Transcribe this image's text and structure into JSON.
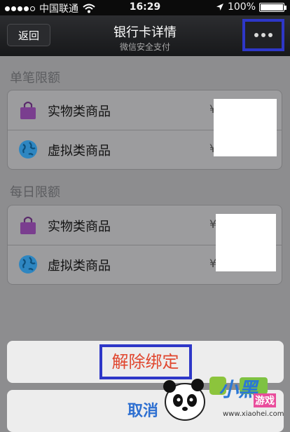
{
  "status_bar": {
    "carrier": "中国联通",
    "time": "16:29",
    "battery_percent": "100%",
    "signal_bars": 4,
    "battery_level": 1.0
  },
  "nav": {
    "back_label": "返回",
    "title": "银行卡详情",
    "subtitle": "微信安全支付",
    "more_icon": "ellipsis-icon"
  },
  "single_limit": {
    "title": "单笔限额",
    "rows": [
      {
        "label": "实物类商品",
        "currency": "¥",
        "icon": "shopping-bag-icon"
      },
      {
        "label": "虚拟类商品",
        "currency": "¥",
        "icon": "globe-icon"
      }
    ]
  },
  "daily_limit": {
    "title": "每日限额",
    "rows": [
      {
        "label": "实物类商品",
        "currency": "¥",
        "icon": "shopping-bag-icon"
      },
      {
        "label": "虚拟类商品",
        "currency": "¥",
        "icon": "globe-icon"
      }
    ]
  },
  "action_sheet": {
    "unbind_label": "解除绑定",
    "cancel_label": "取消"
  },
  "watermark": {
    "brand_a": "小黑",
    "brand_b": "游戏",
    "url": "www.xiaohei.com"
  },
  "colors": {
    "highlight": "#2e37c8",
    "destructive": "#e0462e",
    "cancel": "#2d6fd1",
    "bag": "#7a3e8f",
    "globe": "#2e86c1"
  }
}
